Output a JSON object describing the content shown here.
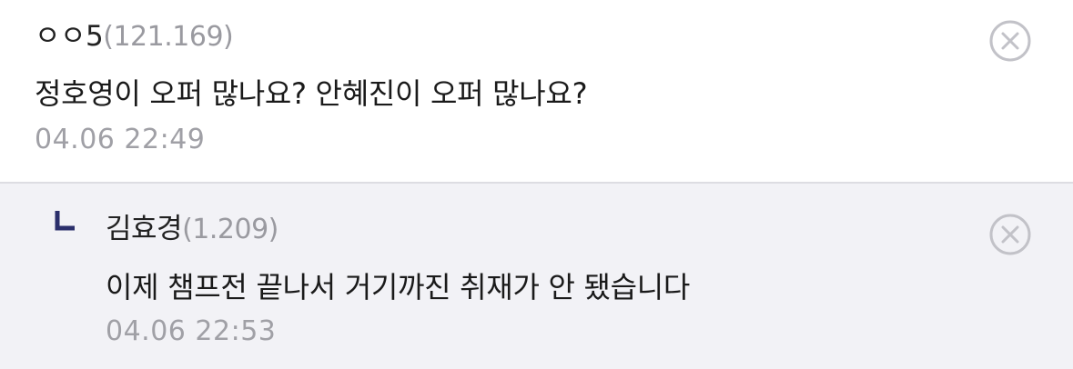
{
  "comments": [
    {
      "author": "ㅇㅇ5",
      "ip": "(121.169)",
      "text": "정호영이 오퍼 많나요? 안혜진이 오퍼 많나요?",
      "date": "04.06 22:49",
      "delete_icon": "circle-x-icon"
    }
  ],
  "replies": [
    {
      "marker_icon": "reply-arrow-icon",
      "author": "김효경",
      "ip": "(1.209)",
      "text": "이제 챔프전 끝나서 거기까진 취재가 안 됐습니다",
      "date": "04.06 22:53",
      "delete_icon": "circle-x-icon"
    }
  ],
  "colors": {
    "reply_background": "#f2f2f6",
    "reply_marker": "#2b2f6b",
    "muted_text": "#a0a0a6"
  }
}
